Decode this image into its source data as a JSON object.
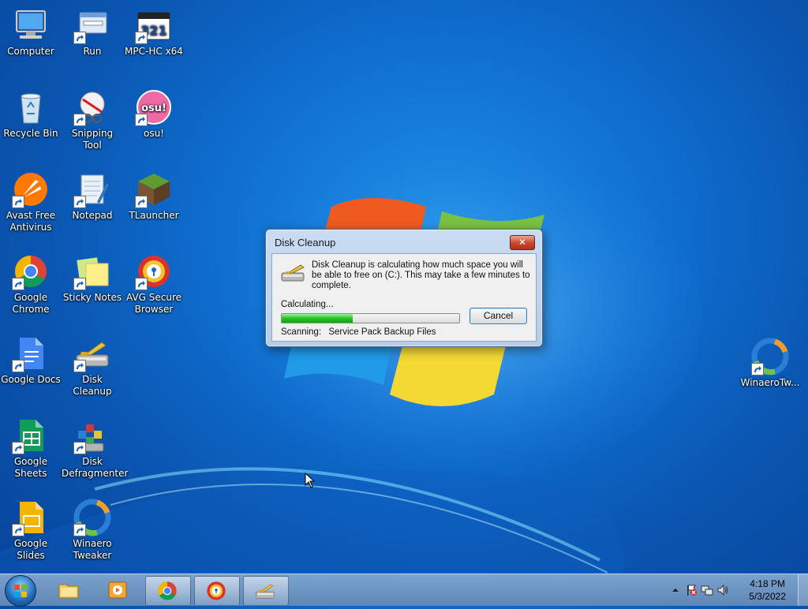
{
  "desktop": {
    "icons": [
      {
        "label": "Computer",
        "icon": "computer-icon"
      },
      {
        "label": "Run",
        "icon": "run-icon"
      },
      {
        "label": "MPC-HC x64",
        "icon": "mpc-hc-icon"
      },
      {
        "label": "Recycle Bin",
        "icon": "recycle-bin-icon"
      },
      {
        "label": "Snipping Tool",
        "icon": "snipping-tool-icon"
      },
      {
        "label": "osu!",
        "icon": "osu-icon"
      },
      {
        "label": "Avast Free Antivirus",
        "icon": "avast-icon"
      },
      {
        "label": "Notepad",
        "icon": "notepad-icon"
      },
      {
        "label": "TLauncher",
        "icon": "tlauncher-icon"
      },
      {
        "label": "Google Chrome",
        "icon": "chrome-icon"
      },
      {
        "label": "Sticky Notes",
        "icon": "sticky-notes-icon"
      },
      {
        "label": "AVG Secure Browser",
        "icon": "avg-browser-icon"
      },
      {
        "label": "Google Docs",
        "icon": "google-docs-icon"
      },
      {
        "label": "Disk Cleanup",
        "icon": "disk-cleanup-icon"
      },
      {
        "label": "Google Sheets",
        "icon": "google-sheets-icon"
      },
      {
        "label": "Disk Defragmenter",
        "icon": "disk-defragmenter-icon"
      },
      {
        "label": "Google Slides",
        "icon": "google-slides-icon"
      },
      {
        "label": "Winaero Tweaker",
        "icon": "winaero-icon"
      },
      {
        "label": "WinaeroTw...",
        "icon": "winaero-icon"
      }
    ],
    "osu_text": "osu!",
    "mpc_text": "321"
  },
  "dialog": {
    "title": "Disk Cleanup",
    "close_label": "✕",
    "message": "Disk Cleanup is calculating how much space you will be able to free on  (C:). This may take a few minutes to complete.",
    "calculating_label": "Calculating...",
    "progress": 0.4,
    "cancel_label": "Cancel",
    "scanning_label": "Scanning:",
    "scanning_item": "Service Pack Backup Files"
  },
  "taskbar": {
    "items": [
      {
        "name": "windows-explorer",
        "icon": "folder-icon",
        "active": false
      },
      {
        "name": "media-player",
        "icon": "media-player-icon",
        "active": false
      },
      {
        "name": "google-chrome",
        "icon": "chrome-icon",
        "active": true
      },
      {
        "name": "avg-secure-browser",
        "icon": "avg-browser-icon",
        "active": true
      },
      {
        "name": "disk-cleanup",
        "icon": "disk-cleanup-icon",
        "active": true
      }
    ],
    "clock_time": "4:18 PM",
    "clock_date": "5/3/2022"
  },
  "colors": {
    "accent": "#0f6fd1",
    "progress_green": "#27c327",
    "close_red": "#c9462b"
  }
}
